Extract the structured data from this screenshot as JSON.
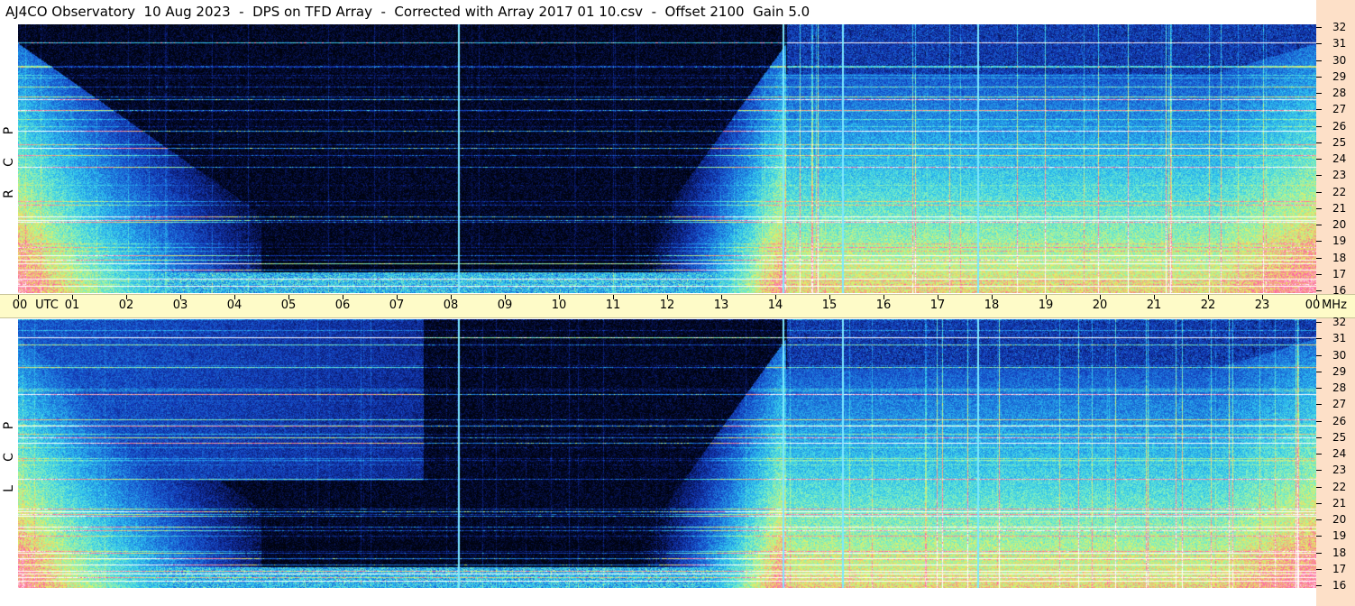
{
  "title": "AJ4CO Observatory  10 Aug 2023  -  DPS on TFD Array  -  Corrected with Array 2017 01 10.csv  -  Offset 2100  Gain 5.0",
  "colors": {
    "background_dark": "#00030f",
    "time_axis_bg": "#fefbc8",
    "freq_axis_bg": "#fde0c8"
  },
  "chart_data": {
    "type": "heatmap",
    "title": "AJ4CO Observatory  10 Aug 2023  -  DPS on TFD Array  -  Corrected with Array 2017 01 10.csv  -  Offset 2100  Gain 5.0",
    "x_unit": "UTC",
    "y_unit": "MHz",
    "x_ticks": [
      "00",
      "01",
      "02",
      "03",
      "04",
      "05",
      "06",
      "07",
      "08",
      "09",
      "10",
      "11",
      "12",
      "13",
      "14",
      "15",
      "16",
      "17",
      "18",
      "19",
      "20",
      "21",
      "22",
      "23",
      "00"
    ],
    "xlim": [
      0,
      24
    ],
    "ylim": [
      16,
      32
    ],
    "y_ticks": [
      "16",
      "17",
      "18",
      "19",
      "20",
      "21",
      "22",
      "23",
      "24",
      "25",
      "26",
      "27",
      "28",
      "29",
      "30",
      "31",
      "32"
    ],
    "panels": [
      {
        "polarization": "RCP",
        "label_letters": [
          "R",
          "C",
          "P"
        ]
      },
      {
        "polarization": "LCP",
        "label_letters": [
          "L",
          "C",
          "P"
        ]
      }
    ],
    "vertical_markers_utc": [
      8.15,
      14.15,
      15.25,
      17.75
    ],
    "colormap": [
      "#00030f",
      "#0a1a70",
      "#1440c0",
      "#1e80e0",
      "#30c8f0",
      "#80f0c0",
      "#e8f060",
      "#ff60a0",
      "#ffffff"
    ]
  }
}
